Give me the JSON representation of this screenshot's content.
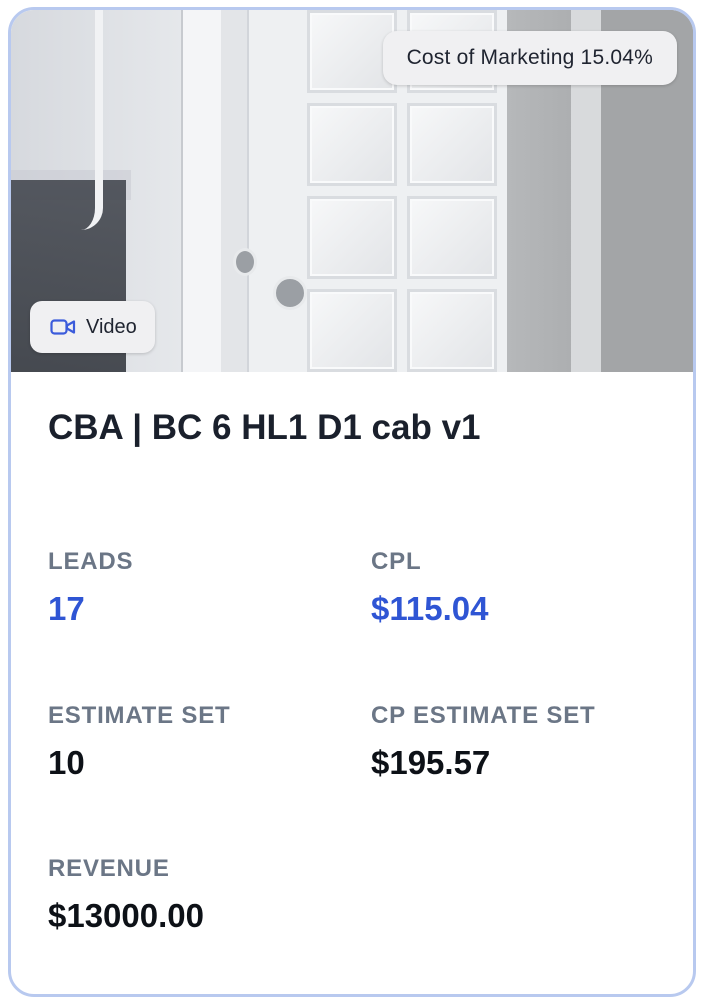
{
  "card": {
    "media": {
      "cost_badge": "Cost of Marketing 15.04%",
      "type_badge": {
        "label": "Video",
        "icon": "video-camera-icon"
      }
    },
    "title": "CBA | BC 6 HL1 D1 cab v1",
    "metrics": {
      "leads": {
        "label": "LEADS",
        "value": "17"
      },
      "cpl": {
        "label": "CPL",
        "value": "$115.04"
      },
      "estimate_set": {
        "label": "ESTIMATE SET",
        "value": "10"
      },
      "cp_estimate_set": {
        "label": "CP ESTIMATE SET",
        "value": "$195.57"
      },
      "revenue": {
        "label": "REVENUE",
        "value": "$13000.00"
      }
    }
  },
  "colors": {
    "accent": "#2f55d4",
    "label": "#6b7686",
    "border": "#b8c9ef"
  }
}
